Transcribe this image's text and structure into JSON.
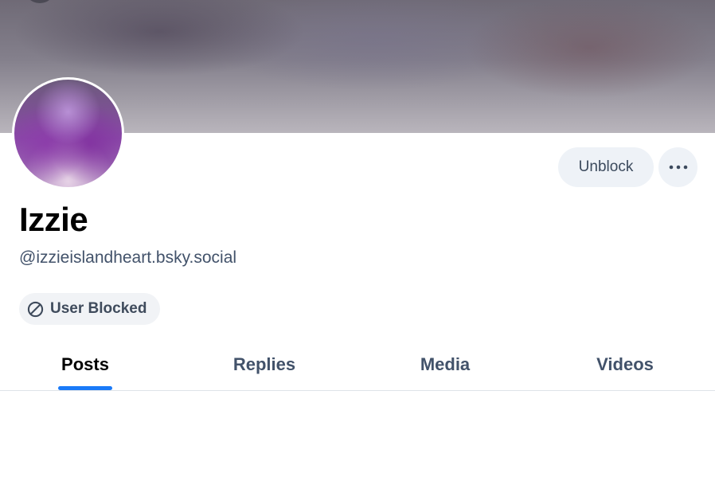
{
  "profile": {
    "display_name": "Izzie",
    "handle": "@izzieislandheart.bsky.social"
  },
  "actions": {
    "unblock_label": "Unblock",
    "more_icon": "ellipsis-icon"
  },
  "badge": {
    "label": "User Blocked",
    "icon": "block-icon"
  },
  "tabs": [
    {
      "label": "Posts",
      "active": true
    },
    {
      "label": "Replies",
      "active": false
    },
    {
      "label": "Media",
      "active": false
    },
    {
      "label": "Videos",
      "active": false
    }
  ],
  "colors": {
    "accent": "#1a7af8",
    "button_bg": "#eef2f7",
    "muted_text": "#42526a"
  }
}
